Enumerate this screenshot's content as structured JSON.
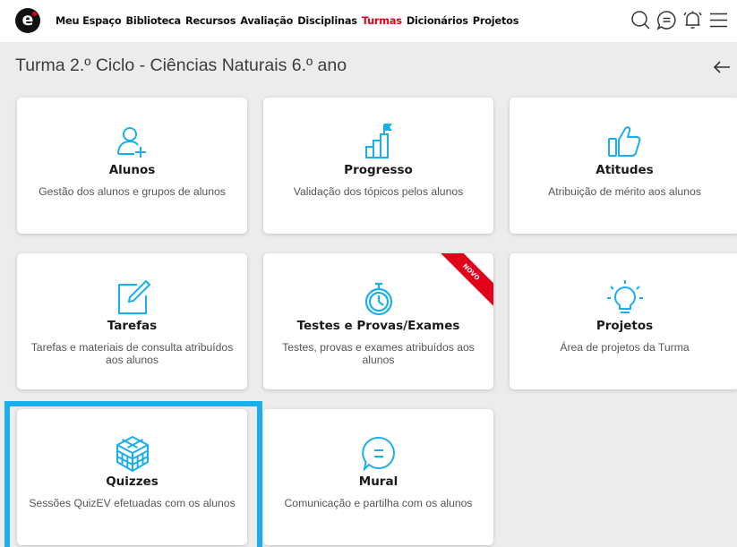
{
  "colors": {
    "accent": "#1aaeea",
    "nav_active": "#e2001a",
    "ribbon": "#e2001a",
    "icon": "#1aaeea"
  },
  "header": {
    "logo_letter": "e",
    "nav": [
      {
        "label": "Meu Espaço",
        "active": false
      },
      {
        "label": "Biblioteca",
        "active": false
      },
      {
        "label": "Recursos",
        "active": false
      },
      {
        "label": "Avaliação",
        "active": false
      },
      {
        "label": "Disciplinas",
        "active": false
      },
      {
        "label": "Turmas",
        "active": true
      },
      {
        "label": "Dicionários",
        "active": false
      },
      {
        "label": "Projetos",
        "active": false
      }
    ],
    "icons": [
      "search-icon",
      "chat-icon",
      "bell-icon",
      "menu-icon"
    ]
  },
  "page": {
    "title": "Turma 2.º Ciclo - Ciências Naturais 6.º ano",
    "back_icon": "arrow-left-icon"
  },
  "cards": [
    {
      "title": "Alunos",
      "desc": "Gestão dos alunos e grupos de alunos",
      "icon": "add-user-icon"
    },
    {
      "title": "Progresso",
      "desc": "Validação dos tópicos pelos alunos",
      "icon": "progress-chart-icon"
    },
    {
      "title": "Atitudes",
      "desc": "Atribuição de mérito aos alunos",
      "icon": "thumbs-up-icon"
    },
    {
      "title": "Tarefas",
      "desc": "Tarefas e materiais de consulta atribuídos aos alunos",
      "icon": "edit-icon"
    },
    {
      "title": "Testes e Provas/Exames",
      "desc": "Testes, provas e exames atribuídos aos alunos",
      "icon": "stopwatch-icon",
      "ribbon": "NOVO"
    },
    {
      "title": "Projetos",
      "desc": "Área de projetos da Turma",
      "icon": "lightbulb-icon"
    },
    {
      "title": "Quizzes",
      "desc": "Sessões QuizEV efetuadas com os alunos",
      "icon": "cube-icon",
      "highlighted": true
    },
    {
      "title": "Mural",
      "desc": "Comunicação e partilha com os alunos",
      "icon": "speech-bubble-icon"
    }
  ]
}
